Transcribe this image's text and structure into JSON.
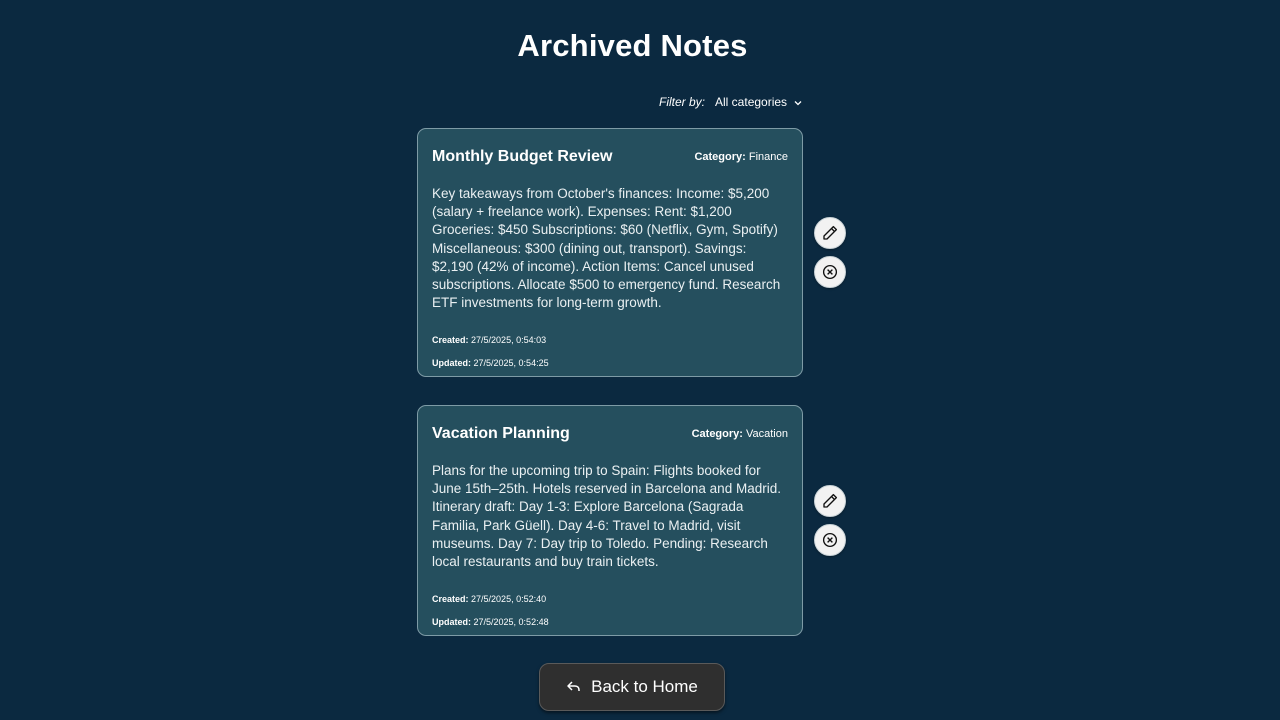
{
  "page": {
    "title": "Archived Notes"
  },
  "filter": {
    "label": "Filter by:",
    "selected": "All categories",
    "icon": "chevron-down-icon"
  },
  "notes": [
    {
      "title": "Monthly Budget Review",
      "category_label": "Category:",
      "category": "Finance",
      "content": "Key takeaways from October's finances: Income: $5,200 (salary + freelance work). Expenses: Rent: $1,200 Groceries: $450 Subscriptions: $60 (Netflix, Gym, Spotify) Miscellaneous: $300 (dining out, transport). Savings: $2,190 (42% of income). Action Items: Cancel unused subscriptions. Allocate $500 to emergency fund. Research ETF investments for long-term growth.",
      "created_label": "Created:",
      "created": "27/5/2025, 0:54:03",
      "updated_label": "Updated:",
      "updated": "27/5/2025, 0:54:25"
    },
    {
      "title": "Vacation Planning",
      "category_label": "Category:",
      "category": "Vacation",
      "content": "Plans for the upcoming trip to Spain: Flights booked for June 15th–25th. Hotels reserved in Barcelona and Madrid. Itinerary draft: Day 1-3: Explore Barcelona (Sagrada Familia, Park Güell). Day 4-6: Travel to Madrid, visit museums. Day 7: Day trip to Toledo. Pending: Research local restaurants and buy train tickets.",
      "created_label": "Created:",
      "created": "27/5/2025, 0:52:40",
      "updated_label": "Updated:",
      "updated": "27/5/2025, 0:52:48"
    }
  ],
  "actions": {
    "edit_icon": "pencil-icon",
    "delete_icon": "close-circle-icon"
  },
  "footer": {
    "back_label": "Back to Home",
    "back_icon": "back-arrow-icon"
  },
  "colors": {
    "background": "#0b2940",
    "card": "#254f5e",
    "card_border": "#7e9ba6",
    "button_dark": "#2f2f2f",
    "icon_button": "#f2f2f2"
  }
}
